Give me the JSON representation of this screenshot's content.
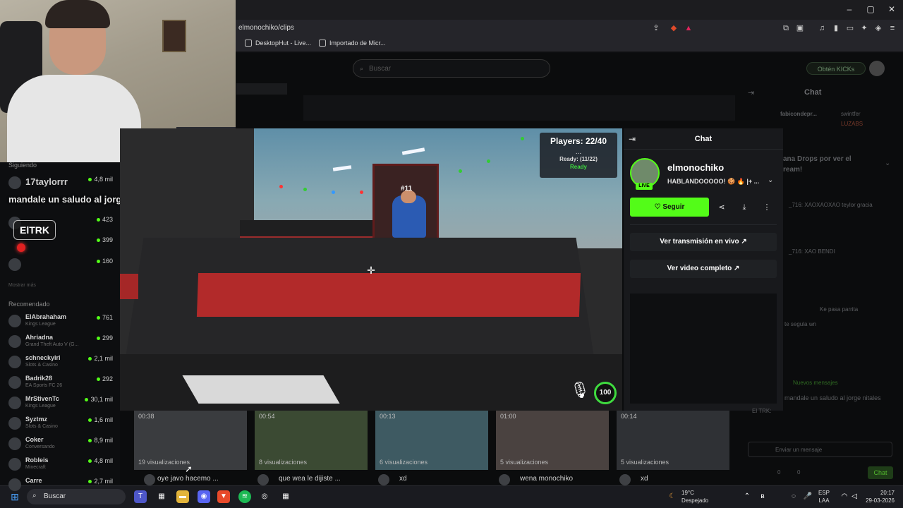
{
  "browser": {
    "url": "elmonochiko/clips",
    "bookmarks": [
      "DesktopHut - Live...",
      "Importado de Micr..."
    ]
  },
  "kick": {
    "search_placeholder": "Buscar",
    "obten_label": "Obtén KICKs",
    "sidebar": {
      "following_header": "Siguiendo",
      "following": [
        {
          "name": "17taylorrr",
          "category": "",
          "count": "4,8 mil"
        },
        {
          "name": "",
          "category": "",
          "count": ""
        },
        {
          "name": "",
          "category": "",
          "count": "423"
        },
        {
          "name": "",
          "category": "",
          "count": "399"
        },
        {
          "name": "",
          "category": "",
          "count": "160"
        }
      ],
      "show_more": "Mostrar más",
      "recommended_header": "Recomendado",
      "recommended": [
        {
          "name": "ElAbrahaham",
          "category": "Kings League",
          "count": "761"
        },
        {
          "name": "Ahriadna",
          "category": "Grand Theft Auto V (G...",
          "count": "299"
        },
        {
          "name": "schneckyiri",
          "category": "Slots & Casino",
          "count": "2,1 mil"
        },
        {
          "name": "Badrik28",
          "category": "EA Sports FC 26",
          "count": "292"
        },
        {
          "name": "MrStivenTc",
          "category": "Kings League",
          "count": "30,1 mil"
        },
        {
          "name": "Syztmz",
          "category": "Slots & Casino",
          "count": "1,6 mil"
        },
        {
          "name": "Coker",
          "category": "Conversando",
          "count": "8,9 mil"
        },
        {
          "name": "Robleis",
          "category": "Minecraft",
          "count": "4,8 mil"
        },
        {
          "name": "Carre",
          "category": "",
          "count": "2,7 mil"
        }
      ]
    },
    "overlay": {
      "message": "mandale un saludo al jorge nitales",
      "tag": "ElTRK"
    },
    "videos": [
      {
        "duration": "00:38",
        "views": "19 visualizaciones",
        "title": "oye javo hacemo ..."
      },
      {
        "duration": "00:54",
        "views": "8 visualizaciones",
        "title": "que wea le dijiste ..."
      },
      {
        "duration": "00:13",
        "views": "6 visualizaciones",
        "title": "xd"
      },
      {
        "duration": "01:00",
        "views": "5 visualizaciones",
        "title": "wena monochiko"
      },
      {
        "duration": "00:14",
        "views": "5 visualizaciones",
        "title": "xd"
      }
    ],
    "right_chat": {
      "title": "Chat",
      "lines": [
        "fabicondepr...",
        "swintfer",
        "LUZABS",
        "ana Drops por ver el",
        "ream!",
        "_716: XAOXAOXAO teylor gracia",
        "_716: XAO BENDI",
        "Ke pasa parrita",
        "te segula wn",
        "Nuevos mensajes",
        "mandale un saludo al jorge nitales",
        "El TRK:"
      ],
      "input_placeholder": "Enviar un mensaje",
      "send_label": "Chat",
      "count_left": "0",
      "count_right": "0"
    }
  },
  "game": {
    "players": "Players: 22/40",
    "dots": "...",
    "ready_count": "Ready: (11/22)",
    "ready_status": "Ready",
    "player_number": "#11",
    "ping": "100"
  },
  "popout": {
    "title": "Chat",
    "channel_name": "elmonochiko",
    "live_label": "LIVE",
    "stream_title": "HABLANDOOOOO! 🍪 🔥 |+ ...",
    "follow_label": "Seguir",
    "watch_live": "Ver transmisión en vivo",
    "watch_full": "Ver video completo"
  },
  "taskbar": {
    "search_label": "Buscar",
    "weather_temp": "19°C",
    "weather_desc": "Despejado",
    "lang1": "ESP",
    "lang2": "LAA",
    "time": "20:17",
    "date": "29-03-2026"
  },
  "colors": {
    "kick_green": "#53fc18",
    "bg": "#0d0e10",
    "couch_red": "#b22a2a"
  }
}
